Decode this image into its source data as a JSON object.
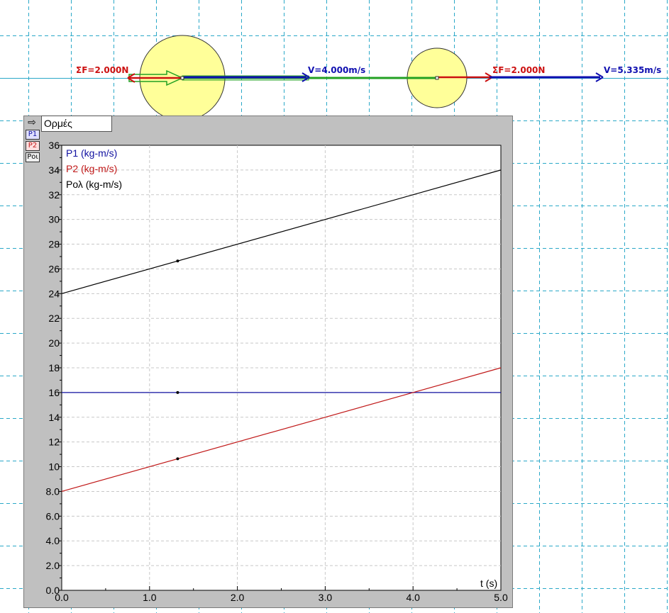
{
  "scene": {
    "force_label_1": "ΣF=2.000N",
    "velocity_label_1": "V=4.000m/s",
    "force_label_2": "ΣF=2.000N",
    "velocity_label_2": "V=5.335m/s"
  },
  "panel": {
    "title": "Ορμές",
    "icon": "arrow-right-icon",
    "buttons": [
      {
        "label": "P1"
      },
      {
        "label": "P2"
      },
      {
        "label": "Ροι"
      }
    ]
  },
  "colors": {
    "p1": "#1010a0",
    "p2": "#c01818",
    "ptotal": "#000000",
    "force": "#cc1010",
    "velocity": "#1010b0",
    "spring": "#22a022",
    "ball": "#ffff99"
  },
  "chart_data": {
    "type": "line",
    "xlabel": "t (s)",
    "xlim": [
      0,
      5
    ],
    "ylim": [
      0,
      36
    ],
    "x_ticks": [
      "0.0",
      "1.0",
      "2.0",
      "3.0",
      "4.0",
      "5.0"
    ],
    "y_ticks": [
      "0.0",
      "2.0",
      "4.0",
      "6.0",
      "8.0",
      "10",
      "12",
      "14",
      "16",
      "18",
      "20",
      "22",
      "24",
      "26",
      "28",
      "30",
      "32",
      "34",
      "36"
    ],
    "grid": true,
    "legend_placement": "top-left",
    "series": [
      {
        "name": "P1 (kg-m/s)",
        "color": "#1010a0",
        "x": [
          0,
          5
        ],
        "y": [
          16,
          16
        ],
        "marker": [
          1.32,
          16
        ]
      },
      {
        "name": "P2 (kg-m/s)",
        "color": "#c01818",
        "x": [
          0,
          5
        ],
        "y": [
          8,
          18
        ],
        "marker": [
          1.32,
          10.64
        ]
      },
      {
        "name": "Ρολ (kg-m/s)",
        "color": "#000000",
        "x": [
          0,
          5
        ],
        "y": [
          24,
          34
        ],
        "marker": [
          1.32,
          26.64
        ]
      }
    ]
  }
}
